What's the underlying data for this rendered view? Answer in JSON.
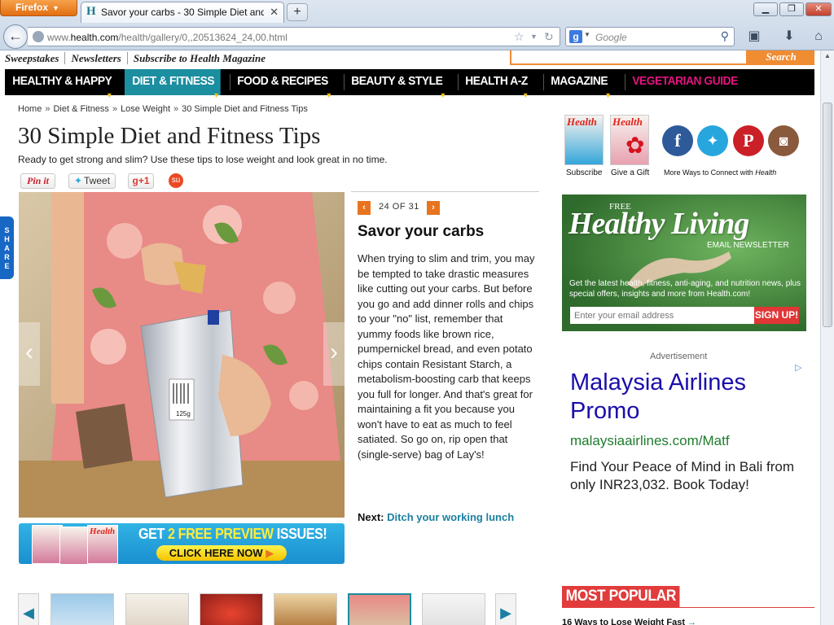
{
  "browser": {
    "menu_button": "Firefox",
    "tab_title": "Savor your carbs - 30 Simple Diet and Fit...",
    "url_prefix": "www.",
    "url_domain": "health.com",
    "url_path": "/health/gallery/0,,20513624_24,00.html",
    "search_engine": "Google",
    "search_placeholder": "Google"
  },
  "site": {
    "top_links": [
      "Sweepstakes",
      "Newsletters",
      "Subscribe to Health Magazine"
    ],
    "search_button": "Search",
    "nav": [
      {
        "label": "HEALTHY & HAPPY",
        "active": false
      },
      {
        "label": "DIET & FITNESS",
        "active": true
      },
      {
        "label": "FOOD & RECIPES",
        "active": false
      },
      {
        "label": "BEAUTY & STYLE",
        "active": false
      },
      {
        "label": "HEALTH A-Z",
        "active": false
      },
      {
        "label": "MAGAZINE",
        "active": false
      },
      {
        "label": "VEGETARIAN GUIDE",
        "active": false
      }
    ]
  },
  "breadcrumb": [
    "Home",
    "Diet & Fitness",
    "Lose Weight",
    "30 Simple Diet and Fitness Tips"
  ],
  "article": {
    "title": "30 Simple Diet and Fitness Tips",
    "subtitle": "Ready to get strong and slim? Use these tips to lose weight and look great in no time.",
    "share": {
      "pinit": "Pin it",
      "tweet": "Tweet",
      "gplus": "g+1"
    },
    "side_share": "SHARE"
  },
  "slide": {
    "counter": "24 OF 31",
    "title": "Savor your carbs",
    "body": "When trying to slim and trim, you may be tempted to take drastic measures like cutting out your carbs. But before you go and add dinner rolls and chips to your \"no\" list, remember that yummy foods like brown rice, pumpernickel bread, and even potato chips contain Resistant Starch, a metabolism-boosting carb that keeps you full for longer. And that's great for maintaining a fit you because you won't have to eat as much to feel satiated. So go on, rip open that (single-serve) bag of Lay's!",
    "next_label": "Next:",
    "next_link": "Ditch your working lunch",
    "bag_label": "125g"
  },
  "promo": {
    "pre": "GET ",
    "highlight": "2 FREE PREVIEW",
    "post": " ISSUES!",
    "cta": "CLICK HERE NOW",
    "cover_brand": "Health"
  },
  "sidebar": {
    "magazine": {
      "brand": "Health",
      "subscribe": "Subscribe",
      "gift": "Give a Gift"
    },
    "connect_label": "More Ways to Connect with",
    "connect_brand": "Health",
    "newsletter": {
      "free": "FREE",
      "title": "Healthy Living",
      "sub": "EMAIL NEWSLETTER",
      "desc": "Get the latest health, fitness, anti-aging, and nutrition news, plus special offers, insights and more from Health.com!",
      "placeholder": "Enter your email address",
      "signup": "SIGN UP!"
    },
    "ad": {
      "label": "Advertisement",
      "headline": "Malaysia Airlines Promo",
      "url": "malaysiaairlines.com/Matf",
      "desc": "Find Your Peace of Mind in Bali from only INR23,032. Book Today!"
    },
    "most_popular": {
      "heading": "MOST POPULAR",
      "first_item": "16 Ways to Lose Weight Fast"
    }
  },
  "colors": {
    "nav_active": "#1b8ea0",
    "accent_orange": "#f08c32",
    "veg_pink": "#e0157f",
    "link_blue": "#1b7fa1",
    "ad_blue": "#1a0dab"
  }
}
